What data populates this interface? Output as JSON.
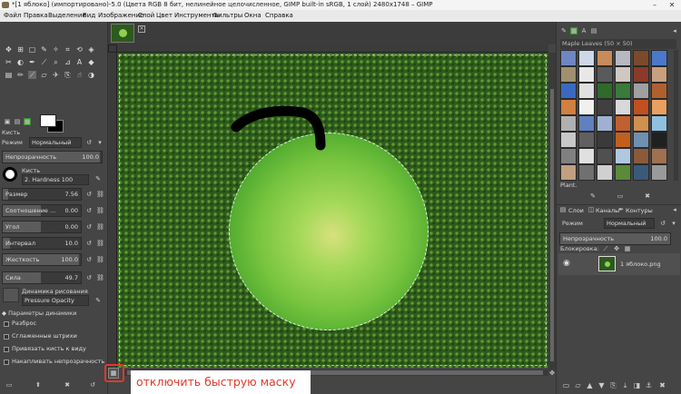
{
  "window": {
    "title": "*[1 яблоко] (импортировано)-5.0 (Цвета RGB 8 бит, нелинейное целочисленное, GIMP built-in sRGB, 1 слой) 2480x1748 – GIMP",
    "minimize": "–",
    "close": "✕"
  },
  "menu": [
    "Файл",
    "Правка",
    "Выделение",
    "Вид",
    "Изображение",
    "Слой",
    "Цвет",
    "Инструменты",
    "Фильтры",
    "Окна",
    "Справка"
  ],
  "tool_options": {
    "tab_label": "Кисть",
    "mode_label": "Режим",
    "mode_value": "Нормальный",
    "opacity_label": "Непрозрачность",
    "opacity_value": "100.0",
    "brush_label": "Кисть",
    "brush_value": "2. Hardness 100",
    "size_label": "Размер",
    "size_value": "7.56",
    "ratio_label": "Соотношение ...",
    "ratio_value": "0.00",
    "angle_label": "Угол",
    "angle_value": "0.00",
    "spacing_label": "Интервал",
    "spacing_value": "10.0",
    "hardness_label": "Жесткость",
    "hardness_value": "100.0",
    "force_label": "Сила",
    "force_value": "49.7",
    "dynamics_label": "Динамика рисования",
    "dynamics_value": "Pressure Opacity",
    "dynamics_params": "Параметры динамики",
    "scatter": "Разброс",
    "smooth": "Сглаженные штрихи",
    "lock_brush": "Привязать кисть к виду",
    "incremental": "Накапливать непрозрачность"
  },
  "levels": {
    "opacity_fill": 1.0,
    "size_fill": 0.07,
    "ratio_fill": 0.5,
    "angle_fill": 0.5,
    "spacing_fill": 0.1,
    "hardness_fill": 1.0,
    "force_fill": 0.5
  },
  "canvas": {
    "quick_mask_annotation": "отключить быструю маску"
  },
  "patterns": {
    "header": "Maple Leaves (50 × 50)",
    "footer": "Plant."
  },
  "layers": {
    "tab_layers": "Слои",
    "tab_channels": "Каналы",
    "tab_paths": "Контуры",
    "mode_label": "Режим",
    "mode_value": "Нормальный",
    "opacity_label": "Непрозрачность",
    "opacity_value": "100.0",
    "lock_label": "Блокировка:",
    "layer_name": "1 яблоко.png"
  },
  "colors": {
    "foreground": "#ffffff",
    "background": "#000000",
    "annotation": "#e0392a"
  }
}
